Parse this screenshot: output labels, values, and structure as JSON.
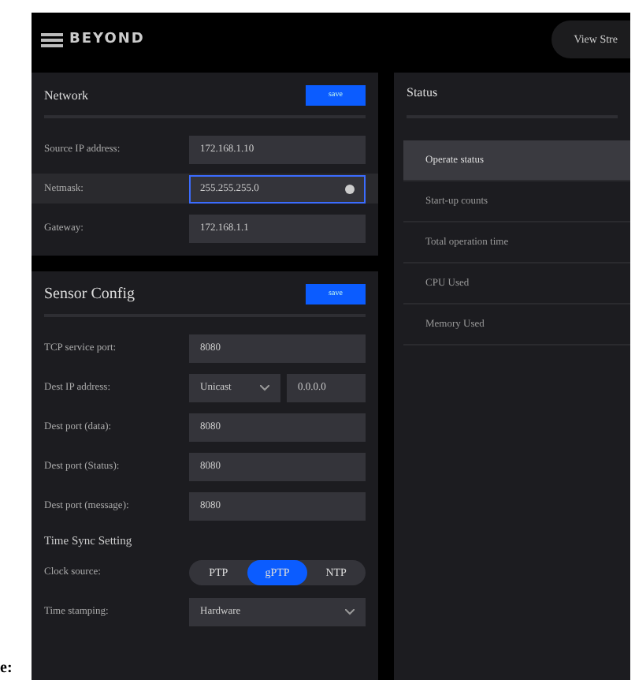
{
  "header": {
    "logo": "BEYOND",
    "button": "View Stre"
  },
  "network": {
    "title": "Network",
    "save": "save",
    "fields": [
      {
        "label": "Source IP address:",
        "value": "172.168.1.10",
        "focused": false
      },
      {
        "label": "Netmask:",
        "value": "255.255.255.0",
        "focused": true
      },
      {
        "label": "Gateway:",
        "value": "172.168.1.1",
        "focused": false
      }
    ]
  },
  "sensor": {
    "title": "Sensor Config",
    "save": "save",
    "fields": [
      {
        "kind": "input",
        "label": "TCP service port:",
        "value": "8080"
      },
      {
        "kind": "select_input",
        "label": "Dest IP address:",
        "value": "Unicast",
        "value2": "0.0.0.0"
      },
      {
        "kind": "input",
        "label": "Dest port (data):",
        "value": "8080"
      },
      {
        "kind": "input",
        "label": "Dest port (Status):",
        "value": "8080"
      },
      {
        "kind": "input",
        "label": "Dest port (message):",
        "value": "8080"
      }
    ],
    "sync_title": "Time Sync Setting",
    "clock": {
      "label": "Clock source:",
      "options": [
        {
          "label": "PTP",
          "selected": false
        },
        {
          "label": "gPTP",
          "selected": true
        },
        {
          "label": "NTP",
          "selected": false
        }
      ]
    },
    "stamping": {
      "label": "Time stamping:",
      "value": "Hardware"
    }
  },
  "status": {
    "title": "Status",
    "items": [
      {
        "label": "Operate status",
        "selected": true
      },
      {
        "label": "Start-up counts",
        "selected": false
      },
      {
        "label": "Total operation time",
        "selected": false
      },
      {
        "label": "CPU Used",
        "selected": false
      },
      {
        "label": "Memory Used",
        "selected": false
      }
    ]
  },
  "margin_text": "e:"
}
